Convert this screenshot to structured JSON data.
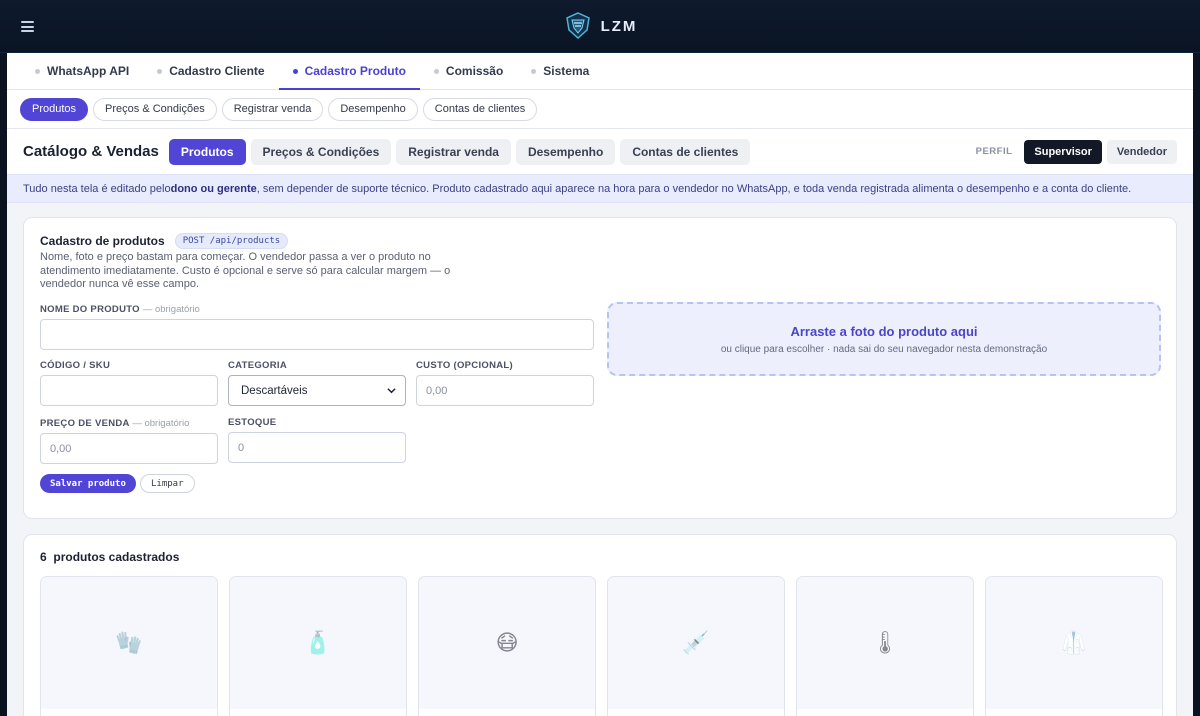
{
  "brand": {
    "name": "LZM"
  },
  "main_tabs": [
    {
      "label": "WhatsApp API",
      "active": false
    },
    {
      "label": "Cadastro Cliente",
      "active": false
    },
    {
      "label": "Cadastro Produto",
      "active": true
    },
    {
      "label": "Comissão",
      "active": false
    },
    {
      "label": "Sistema",
      "active": false
    }
  ],
  "sub_pills": [
    {
      "label": "Produtos",
      "active": true
    },
    {
      "label": "Preços & Condições",
      "active": false
    },
    {
      "label": "Registrar venda",
      "active": false
    },
    {
      "label": "Desempenho",
      "active": false
    },
    {
      "label": "Contas de clientes",
      "active": false
    }
  ],
  "header": {
    "title": "Catálogo & Vendas",
    "segments": [
      {
        "label": "Produtos",
        "active": true
      },
      {
        "label": "Preços & Condições",
        "active": false
      },
      {
        "label": "Registrar venda",
        "active": false
      },
      {
        "label": "Desempenho",
        "active": false
      },
      {
        "label": "Contas de clientes",
        "active": false
      }
    ],
    "perfil_label": "PERFIL",
    "roles": [
      {
        "label": "Supervisor",
        "active": true
      },
      {
        "label": "Vendedor",
        "active": false
      }
    ]
  },
  "notice": {
    "part1": "Tudo nesta tela é editado pelo ",
    "bold": "dono ou gerente",
    "part2": ", sem depender de suporte técnico. Produto cadastrado aqui aparece na hora para o vendedor no WhatsApp, e toda venda registrada alimenta o desempenho e a conta do cliente."
  },
  "form": {
    "title": "Cadastro de produtos",
    "api_tag": "POST /api/products",
    "description": "Nome, foto e preço bastam para começar. O vendedor passa a ver o produto no atendimento imediatamente. Custo é opcional e serve só para calcular margem — o vendedor nunca vê esse campo.",
    "name_label": "NOME DO PRODUTO",
    "required_note": "— obrigatório",
    "name_value": "",
    "sku_label": "CÓDIGO / SKU",
    "sku_value": "",
    "category_label": "CATEGORIA",
    "category_value": "Descartáveis",
    "cost_label": "CUSTO (OPCIONAL)",
    "cost_placeholder": "0,00",
    "price_label": "PREÇO DE VENDA",
    "price_placeholder": "0,00",
    "stock_label": "ESTOQUE",
    "stock_placeholder": "0",
    "dropzone_title": "Arraste a foto do produto aqui",
    "dropzone_sub": "ou clique para escolher · nada sai do seu navegador nesta demonstração",
    "save_label": "Salvar produto",
    "clear_label": "Limpar"
  },
  "products": {
    "count": "6",
    "count_label": "produtos cadastrados",
    "items": [
      {
        "icon": "glove-icon",
        "glyph": "🧤"
      },
      {
        "icon": "bottle-icon",
        "glyph": "🧴"
      },
      {
        "icon": "mask-face-icon",
        "glyph": "😷"
      },
      {
        "icon": "syringe-icon",
        "glyph": "💉"
      },
      {
        "icon": "thermometer-icon",
        "glyph": "🌡"
      },
      {
        "icon": "lab-coat-icon",
        "glyph": "🥼"
      }
    ]
  },
  "colors": {
    "accent": "#5145d6",
    "topbar": "#0e1a2d",
    "notice_bg": "#e9ecfc"
  }
}
